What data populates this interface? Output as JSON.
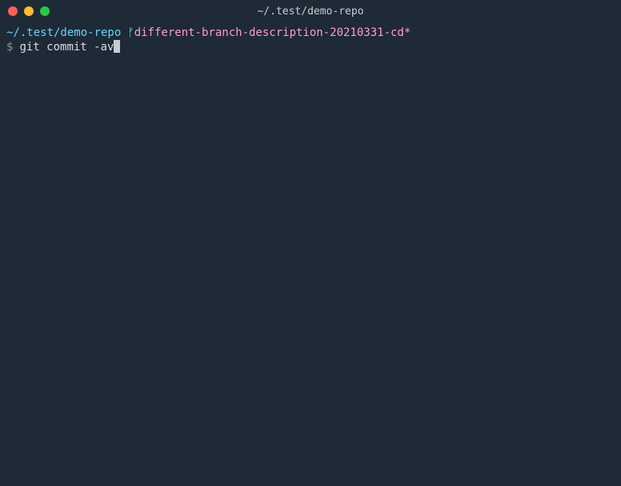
{
  "window": {
    "title": "~/.test/demo-repo"
  },
  "prompt": {
    "path": "~/.test/demo-repo",
    "branch_marker": "ᚠ",
    "branch": "different-branch-description-20210331-cd*",
    "symbol": "$",
    "command": "git commit -av"
  }
}
